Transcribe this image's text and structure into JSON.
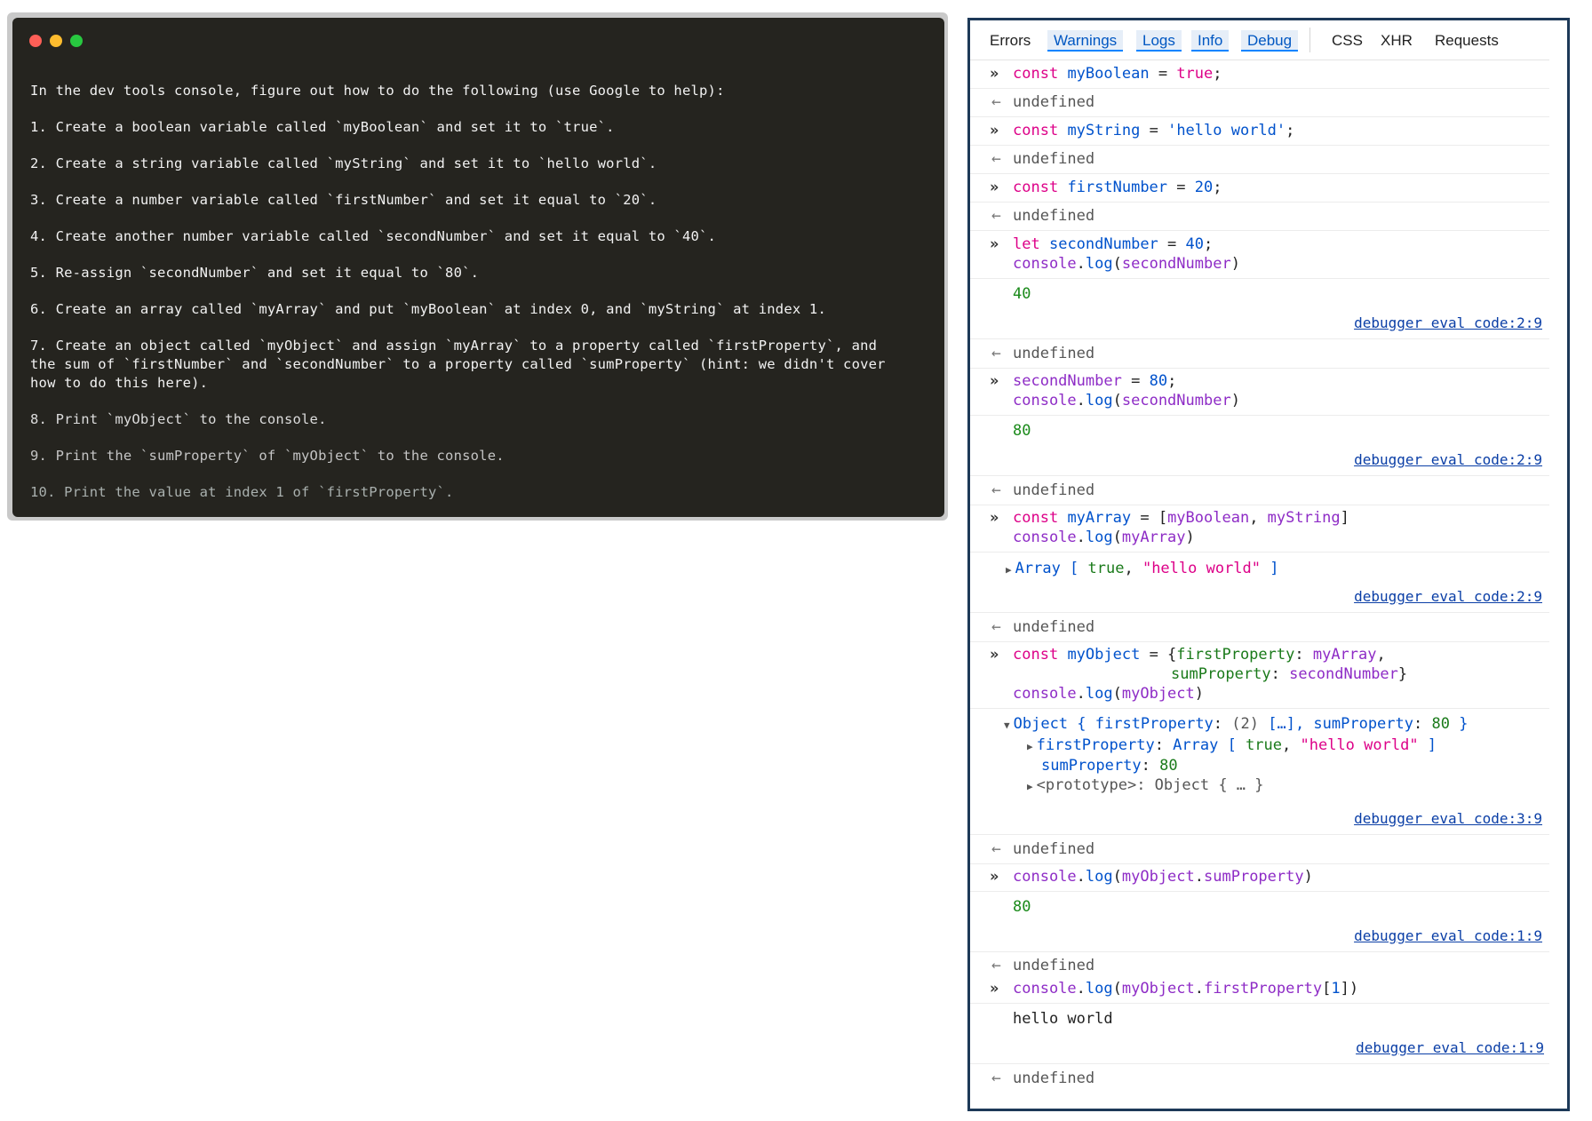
{
  "terminal": {
    "window_dots": [
      "red",
      "yellow",
      "green"
    ],
    "lines": [
      "In the dev tools console, figure out how to do the following (use Google to help):",
      "1. Create a boolean variable called `myBoolean` and set it to `true`.",
      "2. Create a string variable called `myString` and set it to `hello world`.",
      "3. Create a number variable called `firstNumber` and set it equal to `20`.",
      "4. Create another number variable called `secondNumber` and set it equal to `40`.",
      "5. Re-assign `secondNumber` and set it equal to `80`.",
      "6. Create an array called `myArray` and put `myBoolean` at index 0, and `myString` at index 1.",
      "7. Create an object called `myObject` and assign `myArray` to a property called `firstProperty`, and\nthe sum of `firstNumber` and `secondNumber` to a property called `sumProperty` (hint: we didn't cover\nhow to do this here).",
      "8. Print `myObject` to the console.",
      "9. Print the `sumProperty` of `myObject` to the console.",
      "10. Print the value at index 1 of `firstProperty`."
    ]
  },
  "devtools": {
    "filters": {
      "errors": "Errors",
      "warnings": "Warnings",
      "logs": "Logs",
      "info": "Info",
      "debug": "Debug",
      "css": "CSS",
      "xhr": "XHR",
      "requests": "Requests"
    },
    "undefined_text": "undefined",
    "source_link_2_9": "debugger eval code:2:9",
    "source_link_3_9": "debugger eval code:3:9",
    "source_link_1_9": "debugger eval code:1:9",
    "out_40": "40",
    "out_80": "80",
    "out_80b": "80",
    "out_hello": "hello world",
    "prompt_glyph": "»",
    "result_glyph": "←"
  }
}
